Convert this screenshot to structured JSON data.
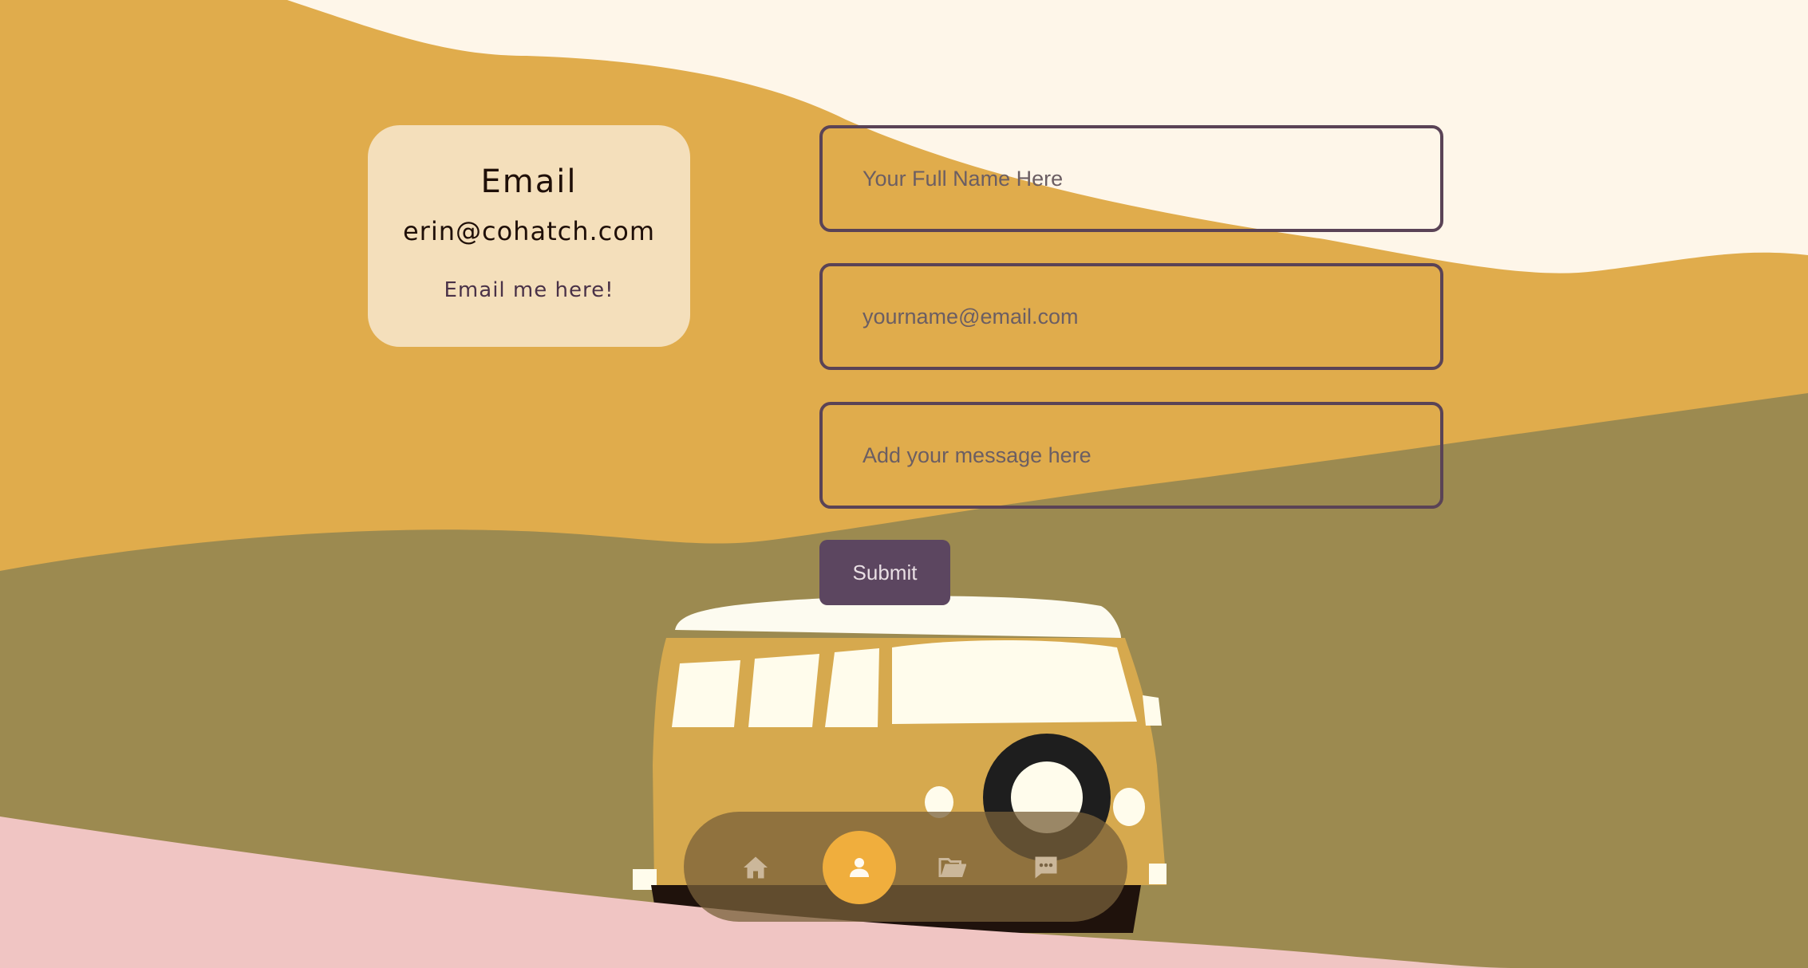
{
  "contact_card": {
    "title": "Email",
    "address": "erin@cohatch.com",
    "link_text": "Email me here!"
  },
  "form": {
    "name_placeholder": "Your Full Name Here",
    "email_placeholder": "yourname@email.com",
    "message_placeholder": "Add your message here",
    "submit_label": "Submit"
  },
  "nav": {
    "items": [
      {
        "icon": "home-icon",
        "active": false
      },
      {
        "icon": "person-icon",
        "active": true
      },
      {
        "icon": "folder-icon",
        "active": false
      },
      {
        "icon": "chat-icon",
        "active": false
      }
    ]
  },
  "colors": {
    "sky": "#fef6e9",
    "mustard_hill": "#e0ac4c",
    "olive_hill": "#9c8a50",
    "pink_ground": "#f0c5c3",
    "card_bg": "#f4dfbb",
    "accent_purple": "#5c4660",
    "nav_active": "#f0ae3d"
  }
}
